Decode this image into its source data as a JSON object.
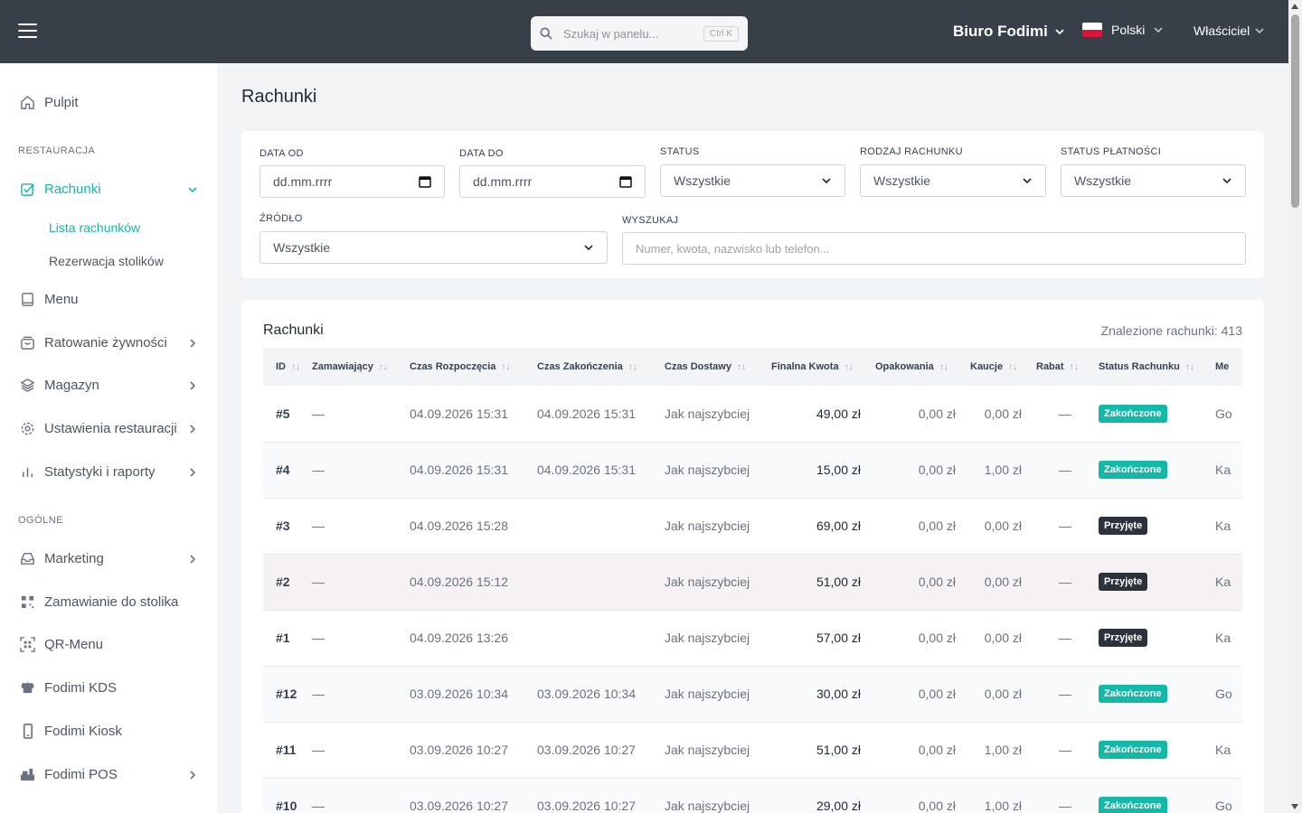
{
  "topbar": {
    "search_placeholder": "Szukaj w panelu...",
    "search_shortcut": "Ctrl K",
    "brand": "Biuro Fodimi",
    "language": "Polski",
    "role": "Właściciel"
  },
  "sidebar": {
    "dashboard": "Pulpit",
    "section_restaurant": "RESTAURACJA",
    "bills": "Rachunki",
    "bills_list": "Lista rachunków",
    "table_reservation": "Rezerwacja stolików",
    "menu": "Menu",
    "food_rescue": "Ratowanie żywności",
    "warehouse": "Magazyn",
    "restaurant_settings": "Ustawienia restauracji",
    "stats": "Statystyki i raporty",
    "section_general": "OGÓLNE",
    "marketing": "Marketing",
    "table_ordering": "Zamawianie do stolika",
    "qr_menu": "QR-Menu",
    "kds": "Fodimi KDS",
    "kiosk": "Fodimi Kiosk",
    "pos": "Fodimi POS"
  },
  "page": {
    "title": "Rachunki"
  },
  "filters": {
    "date_from_label": "DATA OD",
    "date_from_value": "dd.mm.rrrr",
    "date_to_label": "DATA DO",
    "date_to_value": "dd.mm.rrrr",
    "status_label": "STATUS",
    "status_value": "Wszystkie",
    "bill_type_label": "RODZAJ RACHUNKU",
    "bill_type_value": "Wszystkie",
    "payment_status_label": "STATUS PŁATNOŚCI",
    "payment_status_value": "Wszystkie",
    "source_label": "ŹRÓDŁO",
    "source_value": "Wszystkie",
    "search_label": "WYSZUKAJ",
    "search_placeholder": "Numer, kwota, nazwisko lub telefon..."
  },
  "table": {
    "title": "Rachunki",
    "count": "Znalezione rachunki: 413",
    "columns": [
      "ID",
      "Zamawiający",
      "Czas Rozpoczęcia",
      "Czas Zakończenia",
      "Czas Dostawy",
      "Finalna Kwota",
      "Opakowania",
      "Kaucje",
      "Rabat",
      "Status Rachunku",
      "Me"
    ],
    "rows": [
      {
        "id": "#5",
        "orderer": "—",
        "start": "04.09.2026 15:31",
        "end": "04.09.2026 15:31",
        "delivery": "Jak najszybciej",
        "amount": "49,00 zł",
        "packaging": "0,00 zł",
        "deposit": "0,00 zł",
        "discount": "—",
        "status": "Zakończone",
        "status_kind": "done",
        "method": "Go"
      },
      {
        "id": "#4",
        "orderer": "—",
        "start": "04.09.2026 15:31",
        "end": "04.09.2026 15:31",
        "delivery": "Jak najszybciej",
        "amount": "15,00 zł",
        "packaging": "0,00 zł",
        "deposit": "1,00 zł",
        "discount": "—",
        "status": "Zakończone",
        "status_kind": "done",
        "method": "Ka"
      },
      {
        "id": "#3",
        "orderer": "—",
        "start": "04.09.2026 15:28",
        "end": "",
        "delivery": "Jak najszybciej",
        "amount": "69,00 zł",
        "packaging": "0,00 zł",
        "deposit": "0,00 zł",
        "discount": "—",
        "status": "Przyjęte",
        "status_kind": "acc",
        "method": "Ka"
      },
      {
        "id": "#2",
        "orderer": "—",
        "start": "04.09.2026 15:12",
        "end": "",
        "delivery": "Jak najszybciej",
        "amount": "51,00 zł",
        "packaging": "0,00 zł",
        "deposit": "0,00 zł",
        "discount": "—",
        "status": "Przyjęte",
        "status_kind": "acc",
        "method": "Ka"
      },
      {
        "id": "#1",
        "orderer": "—",
        "start": "04.09.2026 13:26",
        "end": "",
        "delivery": "Jak najszybciej",
        "amount": "57,00 zł",
        "packaging": "0,00 zł",
        "deposit": "0,00 zł",
        "discount": "—",
        "status": "Przyjęte",
        "status_kind": "acc",
        "method": "Ka"
      },
      {
        "id": "#12",
        "orderer": "—",
        "start": "03.09.2026 10:34",
        "end": "03.09.2026 10:34",
        "delivery": "Jak najszybciej",
        "amount": "30,00 zł",
        "packaging": "0,00 zł",
        "deposit": "0,00 zł",
        "discount": "—",
        "status": "Zakończone",
        "status_kind": "done",
        "method": "Go"
      },
      {
        "id": "#11",
        "orderer": "—",
        "start": "03.09.2026 10:27",
        "end": "03.09.2026 10:27",
        "delivery": "Jak najszybciej",
        "amount": "51,00 zł",
        "packaging": "0,00 zł",
        "deposit": "1,00 zł",
        "discount": "—",
        "status": "Zakończone",
        "status_kind": "done",
        "method": "Ka"
      },
      {
        "id": "#10",
        "orderer": "—",
        "start": "03.09.2026 10:27",
        "end": "03.09.2026 10:27",
        "delivery": "Jak najszybciej",
        "amount": "29,00 zł",
        "packaging": "0,00 zł",
        "deposit": "1,00 zł",
        "discount": "—",
        "status": "Zakończone",
        "status_kind": "done",
        "method": "Go"
      }
    ]
  },
  "colors": {
    "accent": "#14b8a6",
    "topbar": "#374048",
    "badge_accepted": "#2d333b"
  }
}
